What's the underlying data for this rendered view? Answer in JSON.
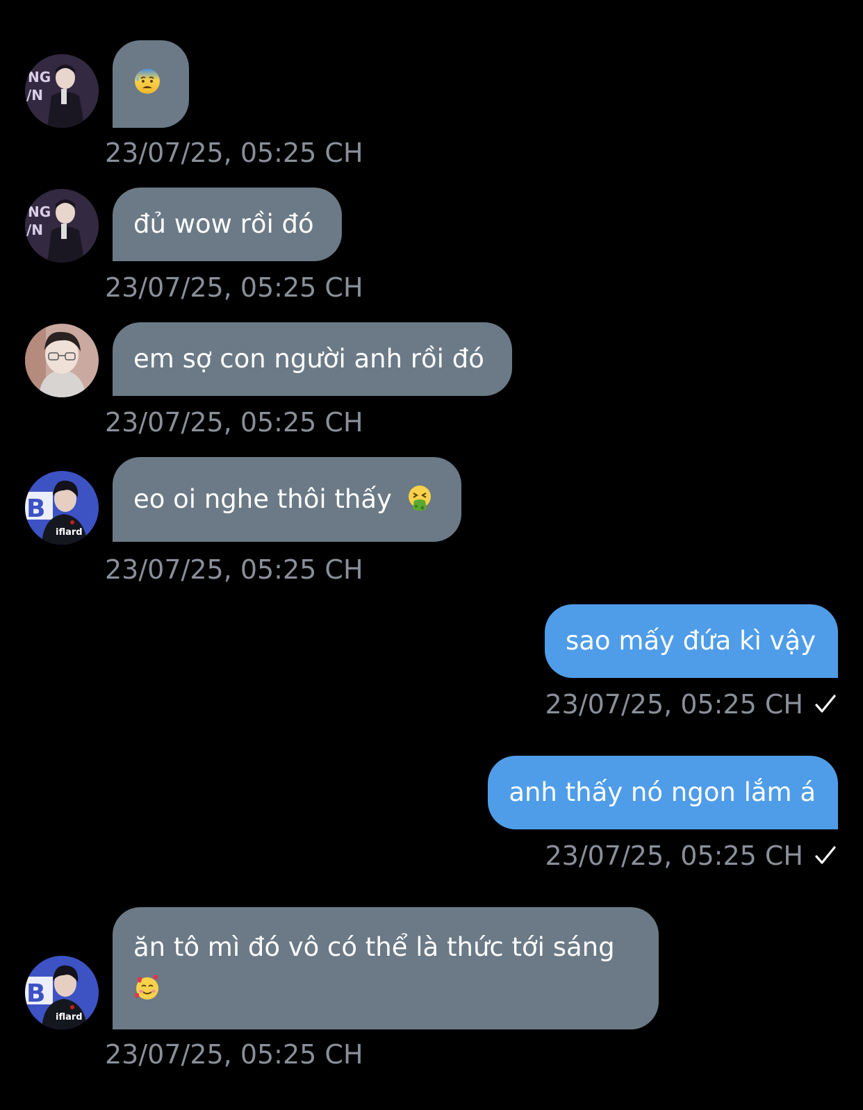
{
  "colors": {
    "background": "#000000",
    "incoming_bubble": "#6b7a86",
    "outgoing_bubble": "#4f9de8",
    "timestamp": "#8a9099"
  },
  "messages": [
    {
      "direction": "incoming",
      "avatar": "avatar-singer",
      "text": "",
      "emoji": "anxious-sweat-face-emoji",
      "timestamp": "23/07/25, 05:25 CH"
    },
    {
      "direction": "incoming",
      "avatar": "avatar-singer",
      "text": "đủ wow rồi đó",
      "timestamp": "23/07/25, 05:25 CH"
    },
    {
      "direction": "incoming",
      "avatar": "avatar-glasses",
      "text": "em sợ con người anh rồi đó",
      "timestamp": "23/07/25, 05:25 CH"
    },
    {
      "direction": "incoming",
      "avatar": "avatar-jersey",
      "text": "eo oi nghe thôi thấy",
      "emoji": "vomiting-face-emoji",
      "timestamp": "23/07/25, 05:25 CH"
    },
    {
      "direction": "outgoing",
      "text": "sao mấy đứa kì vậy",
      "timestamp": "23/07/25, 05:25 CH",
      "status_icon": "checkmark-icon"
    },
    {
      "direction": "outgoing",
      "text": "anh thấy nó ngon lắm á",
      "timestamp": "23/07/25, 05:25 CH",
      "status_icon": "checkmark-icon"
    },
    {
      "direction": "incoming",
      "avatar": "avatar-jersey",
      "text": "ăn tô mì đó vô có thể là thức tới sáng",
      "emoji": "smiling-face-with-hearts-emoji",
      "timestamp": "23/07/25, 05:25 CH"
    }
  ]
}
